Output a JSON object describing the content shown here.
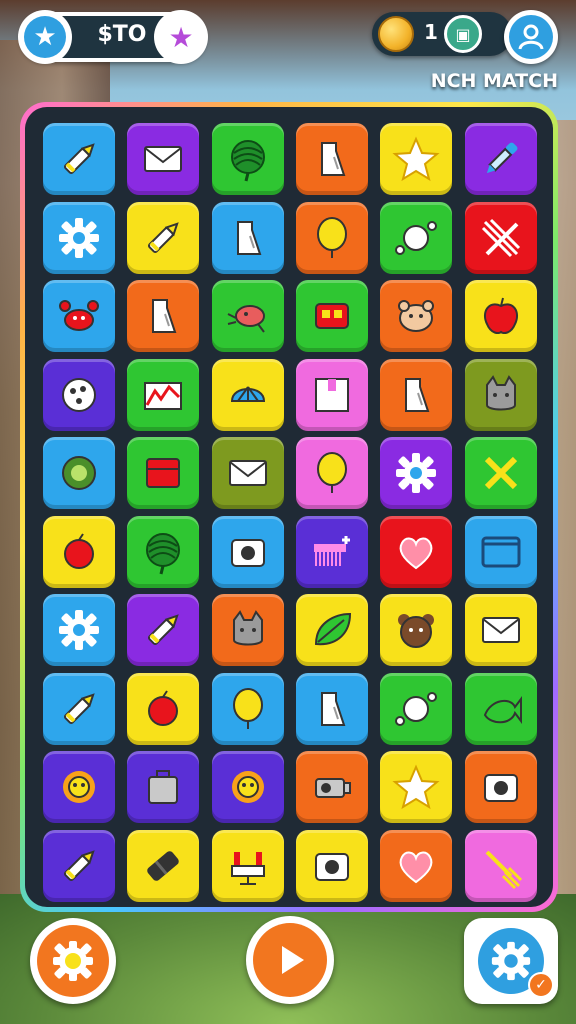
{
  "hud": {
    "score": "$TO",
    "coins": "1",
    "mode": "NCH MATCH",
    "left_star_icon": "star-icon",
    "right_star_icon": "star-icon",
    "shop_icon": "shop-icon",
    "profile_icon": "user-icon"
  },
  "colors": {
    "blue": "#2ea6ec",
    "purple": "#8a2be2",
    "green": "#2fc632",
    "orange": "#f26a1b",
    "yellow": "#f8e11a",
    "red": "#e8141c",
    "pink": "#f06adf",
    "olive": "#7e9a1f",
    "violet": "#5a2fd6"
  },
  "board": {
    "rows": 10,
    "cols": 6,
    "tiles": [
      [
        {
          "color": "blue",
          "icon": "crayon"
        },
        {
          "color": "purple",
          "icon": "envelope"
        },
        {
          "color": "green",
          "icon": "leaf-ball"
        },
        {
          "color": "orange",
          "icon": "bottle"
        },
        {
          "color": "yellow",
          "icon": "star"
        },
        {
          "color": "purple",
          "icon": "dropper"
        }
      ],
      [
        {
          "color": "blue",
          "icon": "gear"
        },
        {
          "color": "yellow",
          "icon": "crayon"
        },
        {
          "color": "blue",
          "icon": "bottle"
        },
        {
          "color": "orange",
          "icon": "balloon"
        },
        {
          "color": "green",
          "icon": "ball-bone"
        },
        {
          "color": "red",
          "icon": "ribbon"
        }
      ],
      [
        {
          "color": "blue",
          "icon": "crab"
        },
        {
          "color": "orange",
          "icon": "bottle"
        },
        {
          "color": "green",
          "icon": "bug"
        },
        {
          "color": "green",
          "icon": "robot"
        },
        {
          "color": "orange",
          "icon": "hamster"
        },
        {
          "color": "yellow",
          "icon": "apple"
        }
      ],
      [
        {
          "color": "violet",
          "icon": "ball"
        },
        {
          "color": "green",
          "icon": "chart"
        },
        {
          "color": "yellow",
          "icon": "shell"
        },
        {
          "color": "pink",
          "icon": "box"
        },
        {
          "color": "orange",
          "icon": "bottle"
        },
        {
          "color": "olive",
          "icon": "cat"
        }
      ],
      [
        {
          "color": "blue",
          "icon": "kiwi"
        },
        {
          "color": "green",
          "icon": "fridge"
        },
        {
          "color": "olive",
          "icon": "envelope"
        },
        {
          "color": "pink",
          "icon": "balloon"
        },
        {
          "color": "purple",
          "icon": "gear"
        },
        {
          "color": "green",
          "icon": "cross"
        }
      ],
      [
        {
          "color": "yellow",
          "icon": "berry"
        },
        {
          "color": "green",
          "icon": "leaf-ball"
        },
        {
          "color": "blue",
          "icon": "camera"
        },
        {
          "color": "violet",
          "icon": "comb"
        },
        {
          "color": "red",
          "icon": "heart"
        },
        {
          "color": "blue",
          "icon": "window"
        }
      ],
      [
        {
          "color": "blue",
          "icon": "gear"
        },
        {
          "color": "purple",
          "icon": "crayon"
        },
        {
          "color": "orange",
          "icon": "cat"
        },
        {
          "color": "yellow",
          "icon": "leaf"
        },
        {
          "color": "yellow",
          "icon": "bear"
        },
        {
          "color": "yellow",
          "icon": "envelope"
        }
      ],
      [
        {
          "color": "blue",
          "icon": "crayon"
        },
        {
          "color": "yellow",
          "icon": "berry"
        },
        {
          "color": "blue",
          "icon": "balloon"
        },
        {
          "color": "blue",
          "icon": "bottle"
        },
        {
          "color": "green",
          "icon": "ball-bone"
        },
        {
          "color": "green",
          "icon": "fish"
        }
      ],
      [
        {
          "color": "violet",
          "icon": "lion"
        },
        {
          "color": "violet",
          "icon": "bag"
        },
        {
          "color": "violet",
          "icon": "lion"
        },
        {
          "color": "orange",
          "icon": "projector"
        },
        {
          "color": "yellow",
          "icon": "star"
        },
        {
          "color": "orange",
          "icon": "camera"
        }
      ],
      [
        {
          "color": "violet",
          "icon": "crayon"
        },
        {
          "color": "yellow",
          "icon": "tube"
        },
        {
          "color": "yellow",
          "icon": "stand"
        },
        {
          "color": "yellow",
          "icon": "camera"
        },
        {
          "color": "orange",
          "icon": "heart"
        },
        {
          "color": "pink",
          "icon": "broom"
        }
      ]
    ]
  },
  "buttons": {
    "settings_icon": "gear-icon",
    "play_icon": "play-icon",
    "options_icon": "gear-icon",
    "badge_icon": "check-icon",
    "badge_text": "✓"
  }
}
